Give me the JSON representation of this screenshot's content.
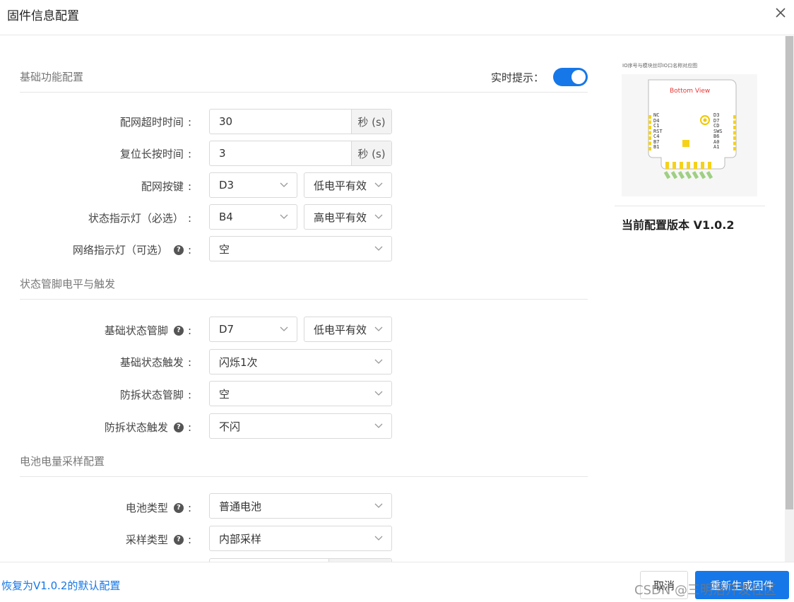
{
  "dialog": {
    "title": "固件信息配置"
  },
  "sections": {
    "basic": "基础功能配置",
    "status_pin": "状态管脚电平与触发",
    "battery": "电池电量采样配置"
  },
  "realtime_hint": {
    "label": "实时提示：",
    "enabled": true
  },
  "fields": {
    "network_timeout": {
      "label": "配网超时时间",
      "value": "30",
      "unit": "秒 (s)"
    },
    "reset_press_time": {
      "label": "复位长按时间",
      "value": "3",
      "unit": "秒 (s)"
    },
    "network_key": {
      "label": "配网按键",
      "pin": "D3",
      "level": "低电平有效"
    },
    "status_led": {
      "label": "状态指示灯（必选）",
      "pin": "B4",
      "level": "高电平有效"
    },
    "network_led": {
      "label": "网络指示灯（可选）",
      "value": "空"
    },
    "basic_status_pin": {
      "label": "基础状态管脚",
      "pin": "D7",
      "level": "低电平有效"
    },
    "basic_status_trigger": {
      "label": "基础状态触发",
      "value": "闪烁1次"
    },
    "tamper_pin": {
      "label": "防拆状态管脚",
      "value": "空"
    },
    "tamper_trigger": {
      "label": "防拆状态触发",
      "value": "不闪"
    },
    "battery_type": {
      "label": "电池类型",
      "value": "普通电池"
    },
    "sample_type": {
      "label": "采样类型",
      "value": "内部采样"
    }
  },
  "colon": ":",
  "preview": {
    "caption": "IO序号与模块丝印IO口名称对应图",
    "view_label": "Bottom View",
    "left_pins": [
      "NC",
      "D4",
      "C1",
      "RST",
      "C4",
      "B7",
      "B1"
    ],
    "right_pins": [
      "D3",
      "D7",
      "CD",
      "SWS",
      "B6",
      "A0",
      "A1"
    ],
    "version": "当前配置版本 V1.0.2"
  },
  "footer": {
    "restore_link": "恢复为V1.0.2的默认配置",
    "cancel": "取消",
    "generate": "重新生成固件",
    "watermark": "CSDN @三明治开发社区"
  },
  "colors": {
    "accent": "#1677e8"
  }
}
